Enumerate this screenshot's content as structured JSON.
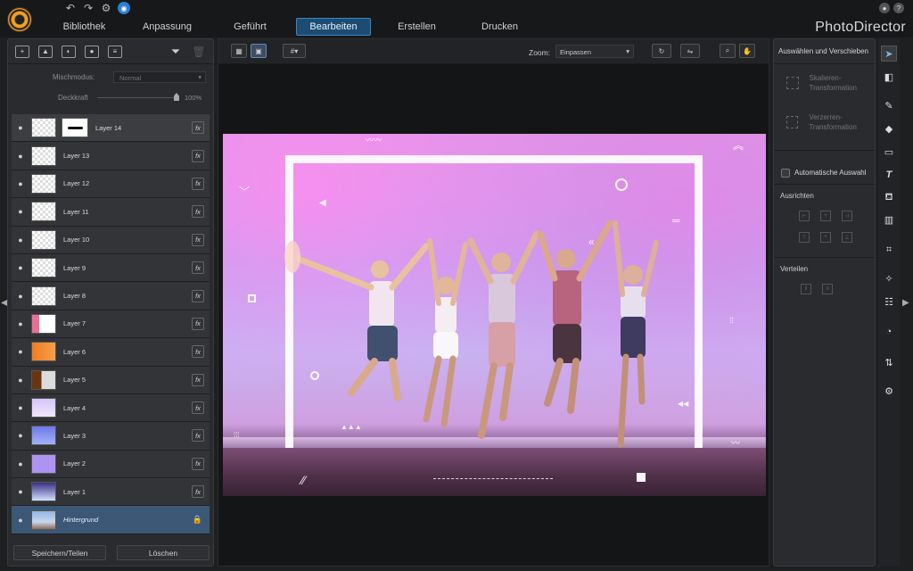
{
  "app": {
    "brand": "PhotoDirector",
    "nav": [
      "Bibliothek",
      "Anpassung",
      "Geführt",
      "Bearbeiten",
      "Erstellen",
      "Drucken"
    ],
    "active_nav": "Bearbeiten",
    "accent": "#3b86c0"
  },
  "layers_panel": {
    "blend_label": "Mischmodus:",
    "blend_value": "Normal",
    "opacity_label": "Deckkraft",
    "opacity_value": "100%",
    "opacity_fraction": 1.0,
    "layers": [
      {
        "name": "Layer 14",
        "has_mask": true
      },
      {
        "name": "Layer 13"
      },
      {
        "name": "Layer 12"
      },
      {
        "name": "Layer 11"
      },
      {
        "name": "Layer 10"
      },
      {
        "name": "Layer 9"
      },
      {
        "name": "Layer 8"
      },
      {
        "name": "Layer 7"
      },
      {
        "name": "Layer 6"
      },
      {
        "name": "Layer 5"
      },
      {
        "name": "Layer 4"
      },
      {
        "name": "Layer 3"
      },
      {
        "name": "Layer 2"
      },
      {
        "name": "Layer 1"
      }
    ],
    "background_layer": "Hintergrund",
    "fx_label": "fx",
    "save_button": "Speichern/Teilen",
    "delete_button": "Löschen"
  },
  "canvas": {
    "zoom_label": "Zoom:",
    "zoom_value": "Einpassen"
  },
  "right_panel": {
    "title": "Auswählen und Verschieben",
    "scale_transform": "Skalieren-Transformation",
    "skew_transform": "Verzerren-Transformation",
    "auto_select": "Automatische Auswahl",
    "align_label": "Ausrichten",
    "distribute_label": "Verteilen"
  }
}
